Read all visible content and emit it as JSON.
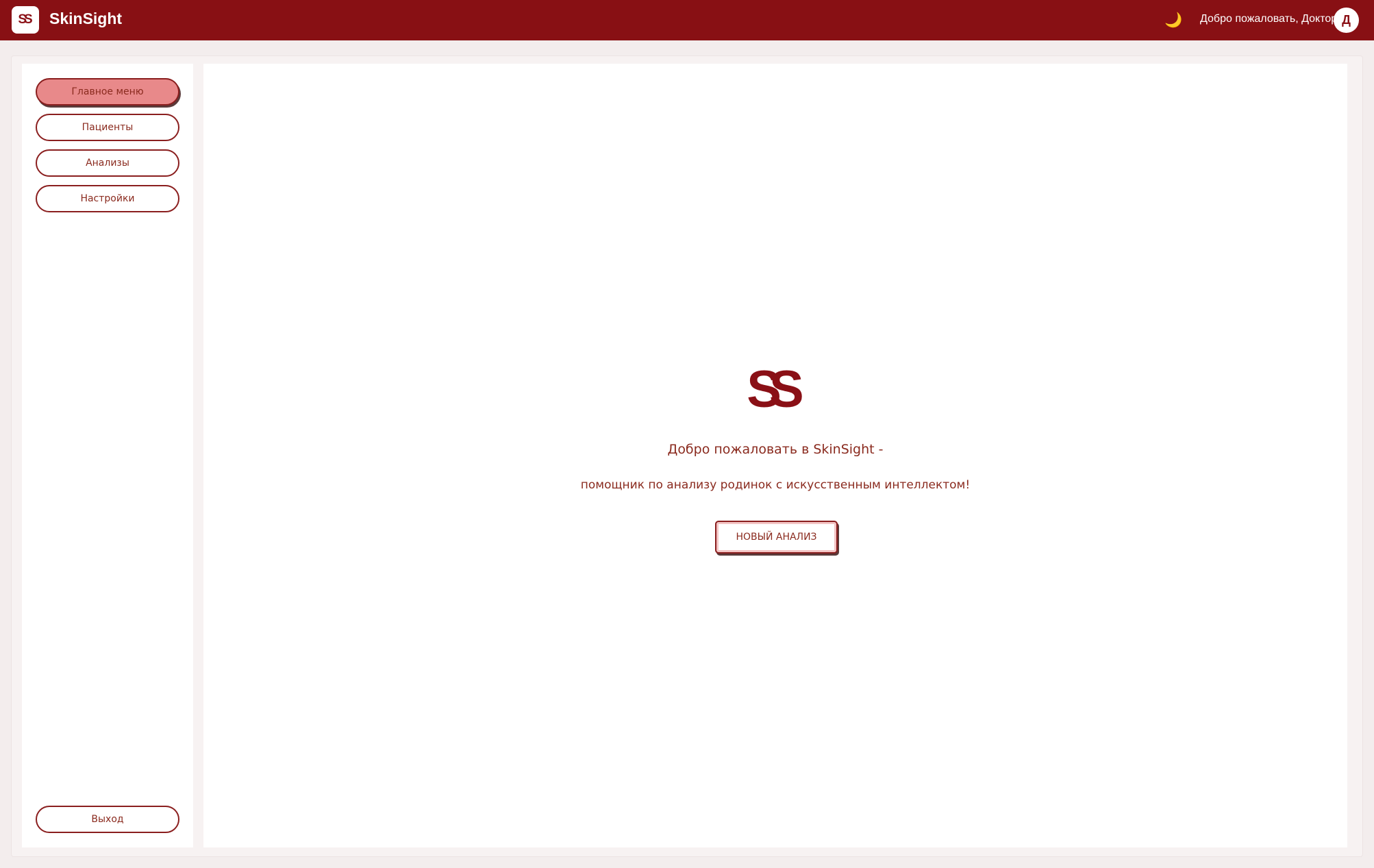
{
  "header": {
    "logo_text": "SS",
    "app_title": "SkinSight",
    "theme_icon": "🌙",
    "welcome_text": "Добро пожаловать, Доктор!",
    "avatar_initial": "Д",
    "colors": {
      "brand": "#881014",
      "accent_moon": "#f1c232"
    }
  },
  "sidebar": {
    "items": [
      {
        "label": "Главное меню",
        "active": true
      },
      {
        "label": "Пациенты",
        "active": false
      },
      {
        "label": "Анализы",
        "active": false
      },
      {
        "label": "Настройки",
        "active": false
      }
    ],
    "logout_label": "Выход",
    "colors": {
      "active_bg": "#e8898a",
      "border": "#8a1e1e"
    }
  },
  "main": {
    "logo_text": "SS",
    "title": "Добро пожаловать в SkinSight -",
    "subtitle": "помощник по анализу родинок с искусственным интеллектом!",
    "new_analysis_label": "НОВЫЙ АНАЛИЗ"
  }
}
